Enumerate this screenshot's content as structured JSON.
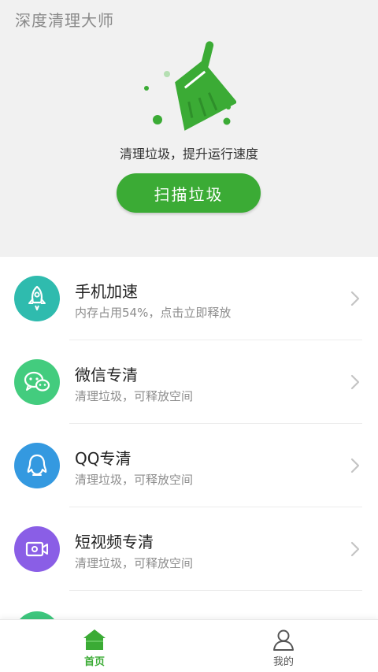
{
  "header": {
    "app_title": "深度清理大师",
    "tagline": "清理垃圾，提升运行速度",
    "scan_label": "扫描垃圾"
  },
  "list": {
    "items": [
      {
        "icon": "rocket-icon",
        "title": "手机加速",
        "subtitle": "内存占用54%，点击立即释放",
        "color": "#2fbbae"
      },
      {
        "icon": "wechat-icon",
        "title": "微信专清",
        "subtitle": "清理垃圾，可释放空间",
        "color": "#43cc7e"
      },
      {
        "icon": "qq-icon",
        "title": "QQ专清",
        "subtitle": "清理垃圾，可释放空间",
        "color": "#3499e0"
      },
      {
        "icon": "video-icon",
        "title": "短视频专清",
        "subtitle": "清理垃圾，可释放空间",
        "color": "#8a5ee6"
      }
    ],
    "memory_usage_percent": 54
  },
  "tabbar": {
    "home_label": "首页",
    "mine_label": "我的",
    "active": "home",
    "accent": "#3bab35"
  },
  "colors": {
    "accent": "#3bab35",
    "hero_bg": "#f1f1f1"
  }
}
